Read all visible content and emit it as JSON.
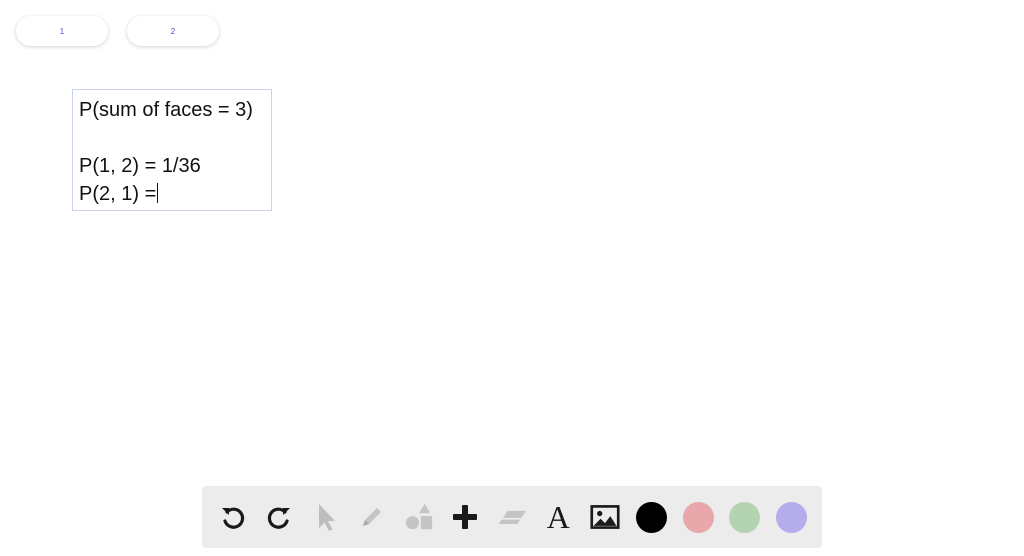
{
  "pages": [
    {
      "label": "1"
    },
    {
      "label": "2"
    }
  ],
  "canvas": {
    "text_lines": [
      "P(sum of faces = 3)",
      "",
      "P(1, 2) = 1/36",
      "P(2, 1) ="
    ]
  },
  "toolbar": {
    "tools": [
      {
        "name": "undo-icon"
      },
      {
        "name": "redo-icon"
      },
      {
        "name": "pointer-icon"
      },
      {
        "name": "pencil-icon"
      },
      {
        "name": "shapes-icon"
      },
      {
        "name": "plus-icon"
      },
      {
        "name": "eraser-icon"
      },
      {
        "name": "text-tool-icon",
        "glyph": "A"
      },
      {
        "name": "image-icon"
      }
    ],
    "colors": [
      "#000000",
      "#e8a7aa",
      "#b4d3b0",
      "#b5acec"
    ]
  }
}
